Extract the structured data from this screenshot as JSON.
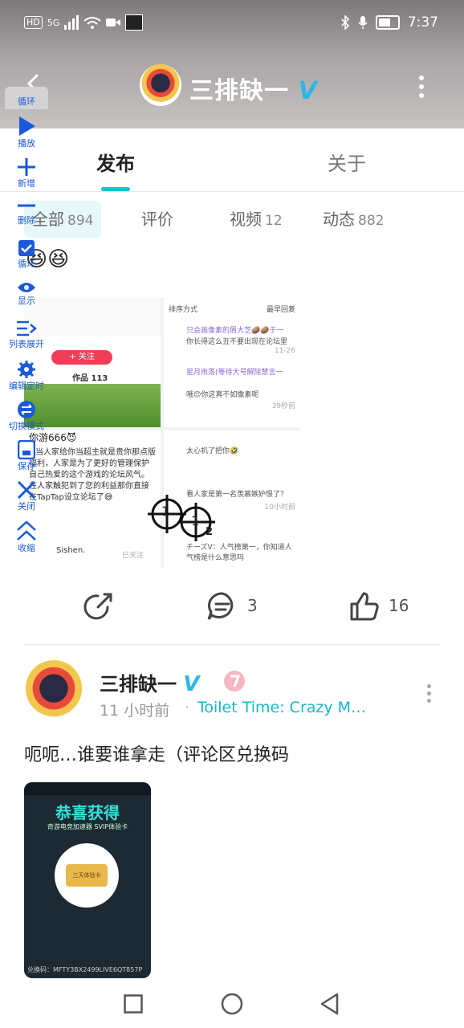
{
  "status_bar": {
    "hd": "HD",
    "network": "5G",
    "time": "7:37"
  },
  "header": {
    "title": "三排缺一",
    "verified_mark": "V"
  },
  "tabs": [
    {
      "label": "发布"
    },
    {
      "label": "关于"
    }
  ],
  "filters": [
    {
      "label": "全部",
      "count": "894"
    },
    {
      "label": "评价",
      "count": ""
    },
    {
      "label": "视频",
      "count": "12"
    },
    {
      "label": "动态",
      "count": "882"
    }
  ],
  "toolbar": [
    {
      "label": "循环",
      "icon": "loop-icon"
    },
    {
      "label": "播放",
      "icon": "play-icon"
    },
    {
      "label": "新增",
      "icon": "plus-icon"
    },
    {
      "label": "删除",
      "icon": "minus-icon"
    },
    {
      "label": "循环",
      "icon": "checkbox-icon"
    },
    {
      "label": "显示",
      "icon": "eye-icon"
    },
    {
      "label": "列表展开",
      "icon": "list-expand-icon"
    },
    {
      "label": "编辑定时",
      "icon": "gear-icon"
    },
    {
      "label": "切换模式",
      "icon": "switch-icon"
    },
    {
      "label": "保存",
      "icon": "save-icon"
    },
    {
      "label": "关闭",
      "icon": "close-icon"
    },
    {
      "label": "收缩",
      "icon": "collapse-icon"
    }
  ],
  "post1": {
    "emoji": "😆😆",
    "grid_texts": {
      "follow": "+ 关注",
      "works": "作品 113",
      "sort": "排序方式",
      "newest": "最早回复",
      "c1_user": "只会画像素的屑大芝🥔🥔于一",
      "c1_text": "你长得这么丑不要出现在论坛里",
      "c1_date": "11-26",
      "c2_user": "星月雨落(等待大号解除禁言一",
      "c2_text": "哦😊你这真不如像素呢",
      "c2_date": "39秒前",
      "tagline1": "你游666😈",
      "tagline2": "当人家给你当超主就是贵你那点版",
      "tagline3": "福利，人家是为了更好的管理保护",
      "tagline4": "自己热爱的这个游戏的论坛风气。",
      "tagline5": "在人家触犯到了您的利益那你直接",
      "tagline6": "在TapTap设立论坛了😅",
      "c3_text": "太心机了把你🤣",
      "c4_text": "看人家是第一名羡慕嫉妒恨了？",
      "c5_text": "チーズV：人气榜第一，你知道人气榜是什么意思吗",
      "c5_date": "10小时前",
      "sishen": "Sishen.",
      "followed": "已关注",
      "marker_a": "1",
      "marker_b": "1",
      "marker_c": "2"
    },
    "share_icon": "share-icon",
    "comments": "3",
    "likes": "16"
  },
  "post2": {
    "author": "三排缺一",
    "verified_mark": "V",
    "time": "11 小时前",
    "game": "Toilet Time: Crazy M…",
    "text": "呃呃…谁要谁拿走（评论区兑换码",
    "img_title": "恭喜获得",
    "img_sub": "奇游电竞加速器 SVIP体验卡",
    "img_card": "三天体验卡",
    "img_code": "兑换码：MFTY3BX2499LIVE6QT857P"
  },
  "colors": {
    "accent": "#14c2d0",
    "verified": "#2fb6e8",
    "toolbar_blue": "#1a5ad8"
  }
}
